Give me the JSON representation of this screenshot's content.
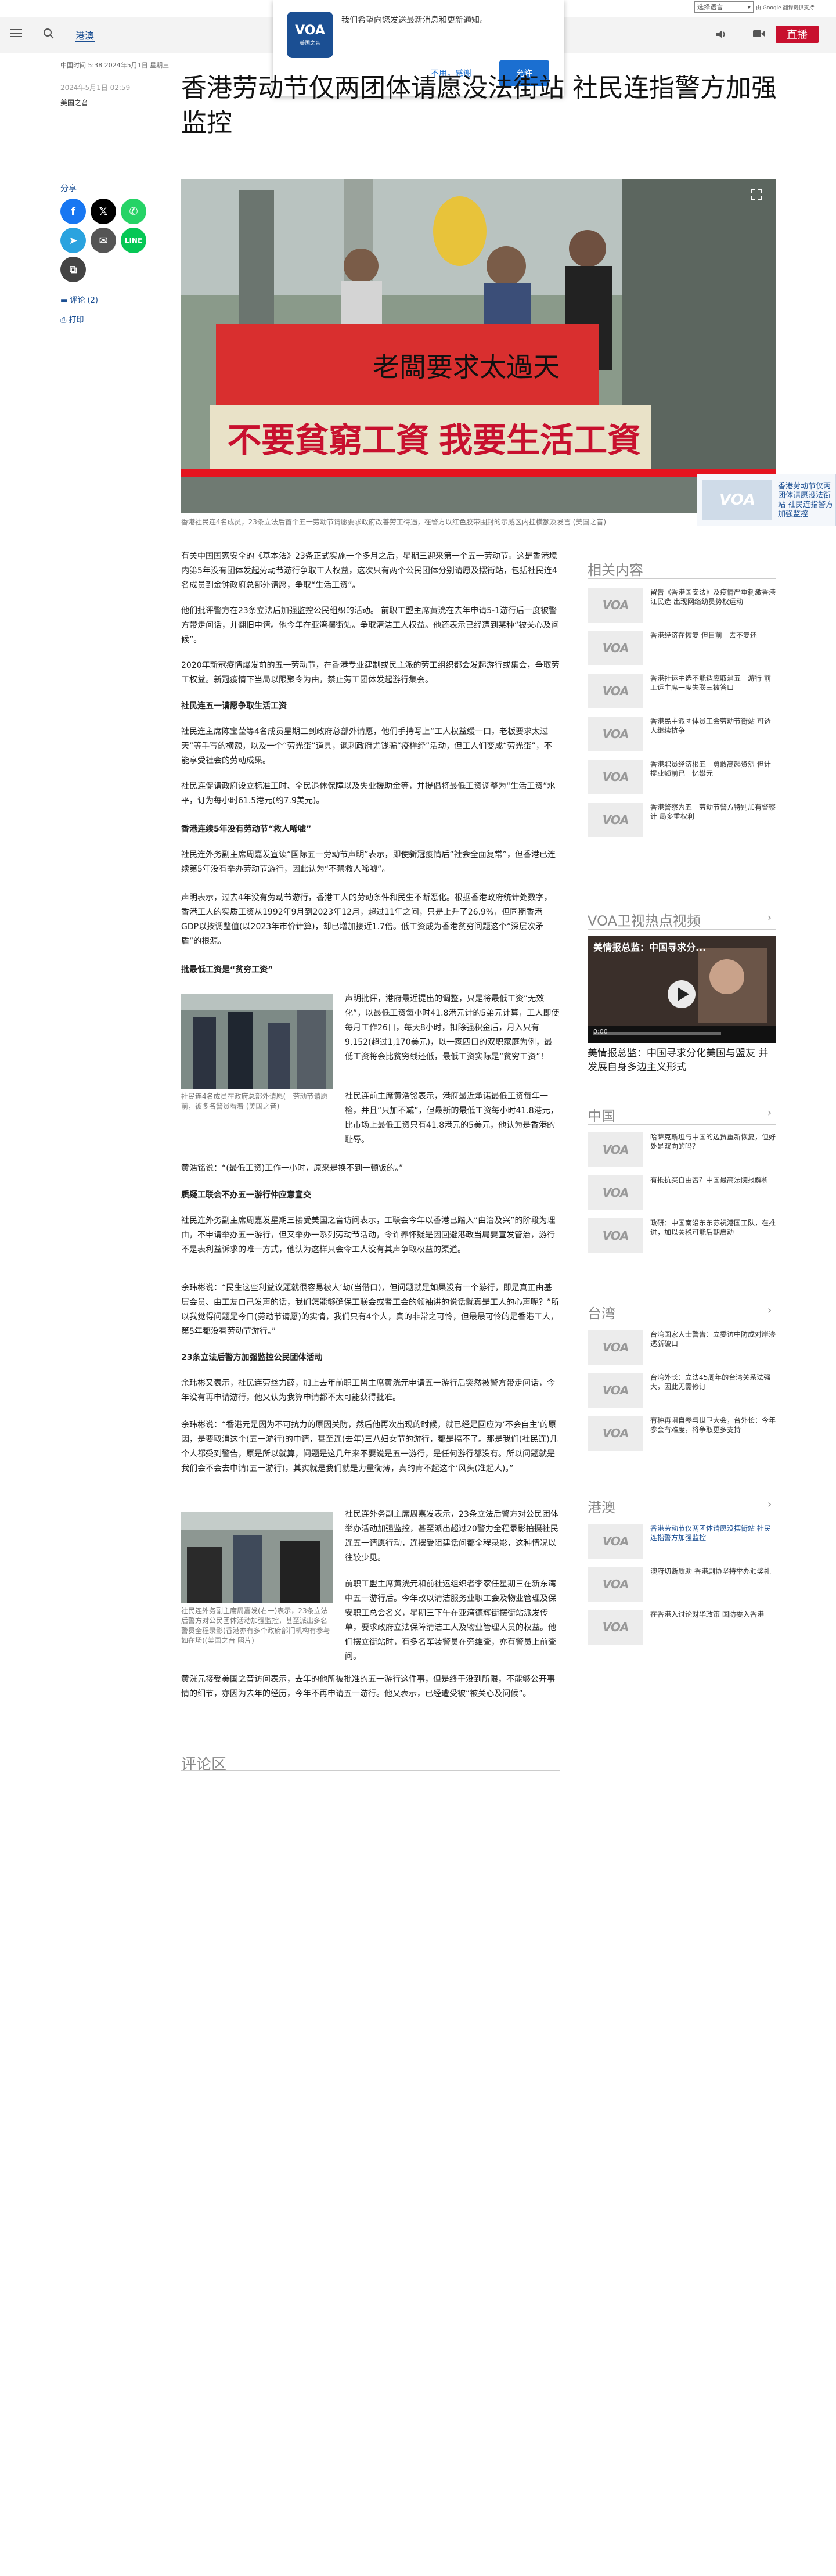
{
  "translate": {
    "select_label": "选择语言",
    "powered": "由 Google 翻译提供支持"
  },
  "header": {
    "section": "港澳",
    "live_label": "直播"
  },
  "popup": {
    "brand": "VOA",
    "brand_sub": "美国之音",
    "message": "我们希望向您发送最新消息和更新通知。",
    "no_label": "不用，感谢",
    "yes_label": "允许"
  },
  "article": {
    "time_notice": "中国时间 5:38 2024年5月1日 星期三",
    "date": "2024年5月1日 02:59",
    "author": "美国之音",
    "title": "香港劳动节仅两团体请愿没法街站 社民连指警方加强监控",
    "share_label": "分享",
    "comments_link": "评论 (2)",
    "print_link": "打印",
    "main_caption": "香港社民连4名成员，23条立法后首个五一劳动节请愿要求政府改善劳工待遇，在警方以红色胶带围封的示威区内挂横额及发言 (美国之音)",
    "banner_text_1": "老闆要求太過天",
    "banner_text_2": "不要貧窮工資 我要生活工資",
    "paragraphs": [
      "有关中国国家安全的《基本法》23条正式实施一个多月之后，星期三迎来第一个五一劳动节。这是香港境内第5年没有团体发起劳动节游行争取工人权益，这次只有两个公民团体分别请愿及摆街站，包括社民连4名成员到金钟政府总部外请愿，争取“生活工资”。",
      "他们批评警方在23条立法后加强监控公民组织的活动。 前职工盟主席黄洸在去年申请5-1游行后一度被警方带走问话，并翻旧申请。他今年在亚湾摆街站。争取清洁工人权益。他还表示已经遭到某种“被关心及问候”。",
      "2020年新冠疫情爆发前的五一劳动节，在香港专业建制或民主派的劳工组织都会发起游行或集会，争取劳工权益。新冠疫情下当局以限聚令为由，禁止劳工团体发起游行集会。",
      "社民连五一请愿争取生活工资",
      "社民连主席陈宝莹等4名成员星期三到政府总部外请愿，他们手持写上“工人权益缓一口，老板要求太过天”等手写的横额，以及一个“劳光蛋”道具，讽刺政府尤钱骗“疫样经”活动，但工人们变成“劳光蛋”，不能享受社会的劳动成果。",
      "社民连促请政府设立标准工时、全民退休保障以及失业援助金等，并提倡将最低工资调整为“生活工资”水平，订为每小时61.5港元(约7.9美元)。",
      "香港连续5年没有劳动节“救人唏嘘”",
      "社民连外务副主席周嘉发宣读“国际五一劳动节声明”表示，即使新冠疫情后“社会全面复常”，但香港已连续第5年没有举办劳动节游行，因此认为“不禁救人唏嘘”。",
      "声明表示，过去4年没有劳动节游行，香港工人的劳动条件和民生不断恶化。根据香港政府统计处数字，香港工人的实质工资从1992年9月到2023年12月，超过11年之间，只是上升了26.9%，但同期香港GDP以按调整值(以2023年市价计算)，却已增加接近1.7倍。低工资成为香港贫穷问题这个“深层次矛盾”的根源。",
      "批最低工资是“贫穷工资”",
      "声明批评，港府最近提出的调整，只是将最低工资“无效化”，以最低工资每小时41.8港元计的5弟元计算，工人即使每月工作26日，每天8小时，扣除强积金后，月入只有9,152(超过1,170美元)，以一家四口的双职家庭为例，最低工资将会比贫穷线还低，最低工资实际是“贫穷工资”！",
      "社民连前主席黄浩铭表示，港府最近承诺最低工资每年一检，并且“只加不减”，但最新的最低工资每小时41.8港元，比市场上最低工资只有41.8港元的5美元，他认为是香港的耻辱。",
      "黄浩铭说：“(最低工资)工作一小时，原来是换不到一顿饭的。”",
      "质疑工联会不办五一游行仲应意宣交",
      "社民连外务副主席周嘉发星期三接受美国之音访问表示，工联会今年以香港已踏入“由治及兴”的阶段为理由，不申请举办五一游行，但又举办一系列劳动节活动，令许养怀疑是因回避港政当局要宣发管治，游行不是表利益诉求的唯一方式，他认为这样只会令工人没有其声争取权益的渠道。",
      "余玮彬说：“民生这些利益议题就很容易被人‘劫(当借口)，但问题就是如果没有一个游行，即是真正由基层会员、由工友自己发声的话，我们怎能够确保工联会或者工会的领袖讲的说话就真是工人的心声呢？”所以我觉得问题是今日(劳动节请愿)的实情，我们只有4个人，真的非常之可怜，但最最可怜的是香港工人，第5年都没有劳动节游行。”",
      "23条立法后警方加强监控公民团体活动",
      "余玮彬又表示，社民连劳丝力薛，加上去年前职工盟主席黄洸元申请五一游行后突然被警方带走问话，今年没有再申请游行，他又认为我算申请都不太可能获得批准。",
      "余玮彬说：“香港元是因为不可抗力的原因关防，然后他再次出现的时候，就已经是回应为‘不会自主’的原因，是要取消这个(五一游行)的申请，甚至连(去年)三八妇女节的游行，都是搞不了。那是我们(社民连)几个人都受到警告，原是所以就算，问题是这几年来不要说是五一游行，是任何游行都没有。所以问题就是我们会不会去申请(五一游行)，其实就是我们就是力量衡薄，真的肯不起这个‘风头(准起人)。”",
      "社民连外务副主席周嘉发表示，23条立法后警方对公民团体举办活动加强监控，甚至派出超过20警力全程录影拍摄社民连五一请愿行动，连摆受阻建话问都全程录影，这种情况以往较少见。",
      "前职工盟主席黄洸元和前社运组织者李家任星期三在新东湾中五一游行后。今年改以清洁服务业职工会及物业管理及保安职工总会名义，星期三下午在亚湾德辉街摆街站派发传单，要求政府立法保障清洁工人及物业管理人员的权益。他们摆立街站时，有多名军装警员在旁维查，亦有警员上前查问。",
      "黄洸元接受美国之音访问表示，去年的他所被批准的五一游行这件事，但是终于没到所限，不能够公开事情的细节，亦因为去年的经历，今年不再申请五一游行。他又表示，已经遭受被“被关心及问候”。"
    ],
    "inline_caption_1": "社民连4名成员在政府总部外请愿(一劳动节请愿前，被多名警员看着 (美国之音)",
    "inline_caption_2": "社民连外务副主席周嘉发(右一)表示，23条立法后警方对公民团体活动加强监控，甚至派出多名警员全程录影(香港亦有多个政府部门机构有参与如在场)(美国之音 照片)",
    "comments_title": "评论区"
  },
  "related_video": {
    "title": "香港劳动节仅两团体请愿没法街站 社民连指警方加强监控"
  },
  "sidebar": {
    "related_title": "相关内容",
    "related": [
      "留告《香港国安法》及疫情严重刺激香港江民选 出现网络幼员势权运动",
      "香港经济在恢复 但目前一去不复还",
      "香港社运主选不能适应取消五一游行 前工运主席一度失联三被答口",
      "香港民主派团体员工会劳动节街站 可透人继续抗争",
      "香港职员经济根五一勇敢高起资烈 但计提业额前已一忆攀元",
      "香港警察为五一劳动节警方特别加有警察计 局多重权利"
    ],
    "video_section": "VOA卫视热点视频",
    "video_overlay_title": "美情报总监：中国寻求分...",
    "video_caption": "美情报总监：中国寻求分化美国与盟友 并发展自身多边主义形式",
    "video_time": "0:00",
    "china_title": "中国",
    "china": [
      "哈萨克斯坦与中国的边贸重新恢复，但好处是双向的吗？",
      "有抵抗买自由否？中国最高法院报解析",
      "政研：中国南沿东东苏祝港国工队，在推进，加以关税可能后期启动"
    ],
    "taiwan_title": "台湾",
    "taiwan": [
      "台湾国家人士警告：立委访中防成对岸渗透新破口",
      "台湾外长：立法45周年的台湾关系法强大，因此无需修订",
      "有种再阻自参与世卫大会，台外长：今年参会有难度，将争取更多支持"
    ],
    "hk_title": "港澳",
    "hk": [
      "香港劳动节仅两团体请愿没摆街站 社民连指警方加强监控",
      "澳府切断质助 香港剧协坚持举办颁奖礼",
      "在香港入讨论对华政策 国防委入香港"
    ]
  },
  "colors": {
    "brand_blue": "#1b4f93",
    "live_red": "#c8102e",
    "facebook": "#1877f2",
    "x": "#000000",
    "whatsapp": "#25d366",
    "telegram": "#2aa3df",
    "email": "#555555",
    "line": "#06c755",
    "copy": "#444444"
  }
}
